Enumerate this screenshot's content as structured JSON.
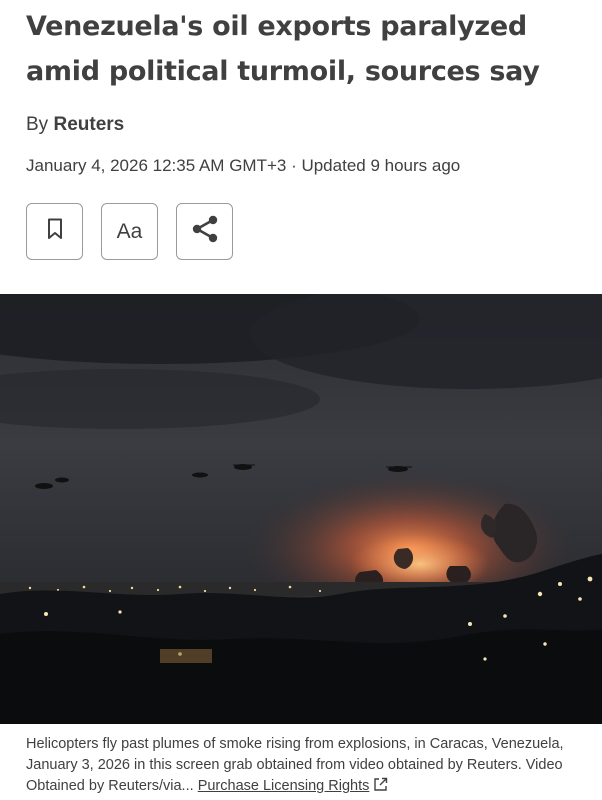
{
  "article": {
    "headline": "Venezuela's oil exports paralyzed amid political turmoil, sources say",
    "byline_prefix": "By",
    "author": "Reuters",
    "dateline": "January 4, 2026 12:35 AM GMT+3 · Updated 9 hours ago"
  },
  "toolbar": {
    "font_size_label": "Aa",
    "bookmark_icon": "bookmark-icon",
    "share_icon": "share-icon"
  },
  "photo": {
    "caption": "Helicopters fly past plumes of smoke rising from explosions, in Caracas, Venezuela, January 3, 2026 in this screen grab obtained from video obtained by Reuters. Video Obtained by Reuters/via...",
    "licensing_link": "Purchase Licensing Rights",
    "licensing_icon": "external-link-icon"
  }
}
